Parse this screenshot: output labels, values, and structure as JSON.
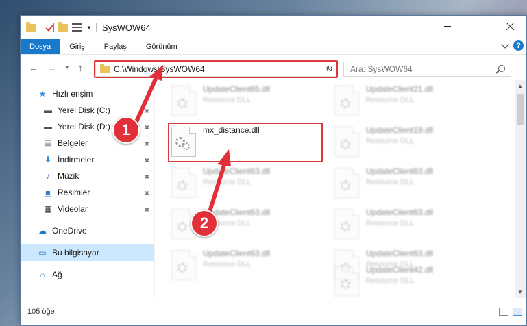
{
  "window": {
    "title": "SysWOW64",
    "colors": {
      "accent": "#1979ca",
      "selection": "#cce8ff",
      "callout": "#e2303a"
    }
  },
  "ribbon": {
    "tabs": [
      {
        "label": "Dosya"
      },
      {
        "label": "Giriş"
      },
      {
        "label": "Paylaş"
      },
      {
        "label": "Görünüm"
      }
    ],
    "help_label": "?"
  },
  "address": {
    "path": "C:\\Windows\\SysWOW64",
    "refresh_glyph": "↻",
    "search_placeholder": "Ara: SysWOW64"
  },
  "sidebar": {
    "items": [
      {
        "label": "Hızlı erişim",
        "icon": "star-icon"
      },
      {
        "label": "Yerel Disk (C:)",
        "icon": "drive-icon",
        "pinned": true
      },
      {
        "label": "Yerel Disk (D:)",
        "icon": "drive-icon",
        "pinned": true
      },
      {
        "label": "Belgeler",
        "icon": "documents-icon",
        "pinned": true
      },
      {
        "label": "İndirmeler",
        "icon": "download-icon",
        "pinned": true
      },
      {
        "label": "Müzik",
        "icon": "music-icon",
        "pinned": true
      },
      {
        "label": "Resimler",
        "icon": "pictures-icon",
        "pinned": true
      },
      {
        "label": "Videolar",
        "icon": "videos-icon",
        "pinned": true
      },
      {
        "label": "OneDrive",
        "icon": "cloud-icon"
      },
      {
        "label": "Bu bilgisayar",
        "icon": "computer-icon",
        "selected": true
      },
      {
        "label": "Ağ",
        "icon": "network-icon"
      }
    ]
  },
  "files": {
    "highlighted": {
      "name": "mx_distance.dll",
      "type": ""
    },
    "left_column": [
      {
        "name": "UpdateClient65.dll",
        "type": "Resource DLL"
      },
      {
        "name": "UpdateClient63.dll",
        "type": "Resource DLL"
      },
      {
        "name": "UpdateClient63.dll",
        "type": "Resource DLL"
      },
      {
        "name": "UpdateClient63.dll",
        "type": "Resource DLL"
      }
    ],
    "right_column": [
      {
        "name": "UpdateClient21.dll",
        "type": "Resource DLL"
      },
      {
        "name": "UpdateClient19.dll",
        "type": "Resource DLL"
      },
      {
        "name": "UpdateClient63.dll",
        "type": "Resource DLL"
      },
      {
        "name": "UpdateClient63.dll",
        "type": "Resource DLL"
      },
      {
        "name": "UpdateClient63.dll",
        "type": "Resource DLL"
      },
      {
        "name": "UpdateClient42.dll",
        "type": "Resource DLL"
      }
    ]
  },
  "status": {
    "item_count": "105 öğe"
  },
  "callouts": [
    {
      "number": "1"
    },
    {
      "number": "2"
    }
  ]
}
